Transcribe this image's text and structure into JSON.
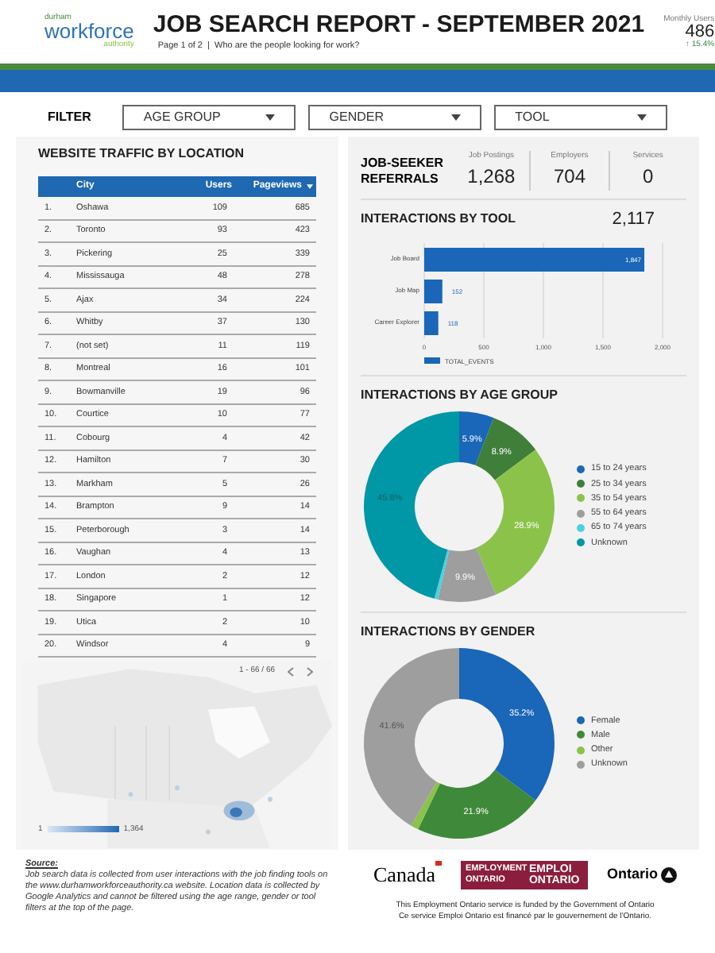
{
  "header": {
    "logo": {
      "top": "durham",
      "main": "workforce",
      "bottom": "authority"
    },
    "title": "JOB SEARCH REPORT - SEPTEMBER 2021",
    "subtitle": "Page 1 of 2  |  Who are the people looking for work?",
    "monthly_users": {
      "label": "Monthly Users",
      "value": "486",
      "change": "↑ 15.4%"
    }
  },
  "filter": {
    "label": "FILTER",
    "dropdowns": [
      "AGE GROUP",
      "GENDER",
      "TOOL"
    ]
  },
  "traffic": {
    "title": "WEBSITE TRAFFIC BY LOCATION",
    "columns": [
      "City",
      "Users",
      "Pageviews"
    ],
    "rows": [
      {
        "rank": "1.",
        "city": "Oshawa",
        "users": "109",
        "pageviews": "685"
      },
      {
        "rank": "2.",
        "city": "Toronto",
        "users": "93",
        "pageviews": "423"
      },
      {
        "rank": "3.",
        "city": "Pickering",
        "users": "25",
        "pageviews": "339"
      },
      {
        "rank": "4.",
        "city": "Mississauga",
        "users": "48",
        "pageviews": "278"
      },
      {
        "rank": "5.",
        "city": "Ajax",
        "users": "34",
        "pageviews": "224"
      },
      {
        "rank": "6.",
        "city": "Whitby",
        "users": "37",
        "pageviews": "130"
      },
      {
        "rank": "7.",
        "city": "(not set)",
        "users": "11",
        "pageviews": "119"
      },
      {
        "rank": "8.",
        "city": "Montreal",
        "users": "16",
        "pageviews": "101"
      },
      {
        "rank": "9.",
        "city": "Bowmanville",
        "users": "19",
        "pageviews": "96"
      },
      {
        "rank": "10.",
        "city": "Courtice",
        "users": "10",
        "pageviews": "77"
      },
      {
        "rank": "11.",
        "city": "Cobourg",
        "users": "4",
        "pageviews": "42"
      },
      {
        "rank": "12.",
        "city": "Hamilton",
        "users": "7",
        "pageviews": "30"
      },
      {
        "rank": "13.",
        "city": "Markham",
        "users": "5",
        "pageviews": "26"
      },
      {
        "rank": "14.",
        "city": "Brampton",
        "users": "9",
        "pageviews": "14"
      },
      {
        "rank": "15.",
        "city": "Peterborough",
        "users": "3",
        "pageviews": "14"
      },
      {
        "rank": "16.",
        "city": "Vaughan",
        "users": "4",
        "pageviews": "13"
      },
      {
        "rank": "17.",
        "city": "London",
        "users": "2",
        "pageviews": "12"
      },
      {
        "rank": "18.",
        "city": "Singapore",
        "users": "1",
        "pageviews": "12"
      },
      {
        "rank": "19.",
        "city": "Utica",
        "users": "2",
        "pageviews": "10"
      },
      {
        "rank": "20.",
        "city": "Windsor",
        "users": "4",
        "pageviews": "9"
      }
    ],
    "pagination": "1 - 66 / 66",
    "map_legend": {
      "min": "1",
      "max": "1,364"
    }
  },
  "source": {
    "heading": "Source:",
    "text": "Job search data is collected from user interactions with the job finding tools on the www.durhamworkforceauthority.ca website.  Location data is collected by Google Analytics and cannot be filtered using the age range, gender or tool filters at the top of the page."
  },
  "referrals": {
    "title": "JOB-SEEKER REFERRALS",
    "stats": [
      {
        "label": "Job Postings",
        "value": "1,268"
      },
      {
        "label": "Employers",
        "value": "704"
      },
      {
        "label": "Services",
        "value": "0"
      }
    ]
  },
  "tool": {
    "title": "INTERACTIONS BY TOOL",
    "total": "2,117",
    "chart_data": {
      "type": "bar",
      "orientation": "horizontal",
      "categories": [
        "Job Board",
        "Job Map",
        "Career Explorer"
      ],
      "series": [
        {
          "name": "TOTAL_EVENTS",
          "color": "#1a66b8",
          "values": [
            1847,
            152,
            118
          ]
        }
      ],
      "xlim": [
        0,
        2000
      ],
      "grid": true,
      "legend": true,
      "xticks": [
        {
          "value": 0,
          "label": "0"
        },
        {
          "value": 500,
          "label": "500"
        },
        {
          "value": 1000,
          "label": "1,000"
        },
        {
          "value": 1500,
          "label": "1,500"
        },
        {
          "value": 2000,
          "label": "2,000"
        }
      ],
      "value_labels": [
        "1,847",
        "152",
        "118"
      ]
    }
  },
  "age": {
    "title": "INTERACTIONS BY AGE GROUP",
    "chart_data": {
      "type": "donut",
      "categories": [
        "15 to 24 years",
        "25 to 34 years",
        "35 to 54 years",
        "55 to 64 years",
        "65 to 74 years",
        "Unknown"
      ],
      "legend": true,
      "colors": [
        "#1a66b8",
        "#3f7f3a",
        "#8bc34a",
        "#9e9e9e",
        "#4dd0e1",
        "#0097a7"
      ],
      "values": [
        5.9,
        8.9,
        28.9,
        9.9,
        0.6,
        45.8
      ],
      "value_labels": [
        "5.9%",
        "8.9%",
        "28.9%",
        "9.9%",
        null,
        "45.8%"
      ]
    }
  },
  "gender": {
    "title": "INTERACTIONS BY GENDER",
    "chart_data": {
      "type": "donut",
      "categories": [
        "Female",
        "Male",
        "Other",
        "Unknown"
      ],
      "legend": true,
      "colors": [
        "#1a66b8",
        "#3f8a3a",
        "#8bc34a",
        "#9e9e9e"
      ],
      "values": [
        35.2,
        21.9,
        1.3,
        41.6
      ],
      "value_labels": [
        "35.2%",
        "21.9%",
        null,
        "41.6%"
      ]
    }
  },
  "footer": {
    "canada": "Canada",
    "eo_en": "EMPLOYMENT ONTARIO",
    "eo_fr": "EMPLOI ONTARIO",
    "ontario": "Ontario",
    "funding": [
      "This Employment Ontario service is funded by the Government of Ontario",
      "Ce service Emploi Ontario est financé par le gouvernement de l'Ontario."
    ]
  }
}
